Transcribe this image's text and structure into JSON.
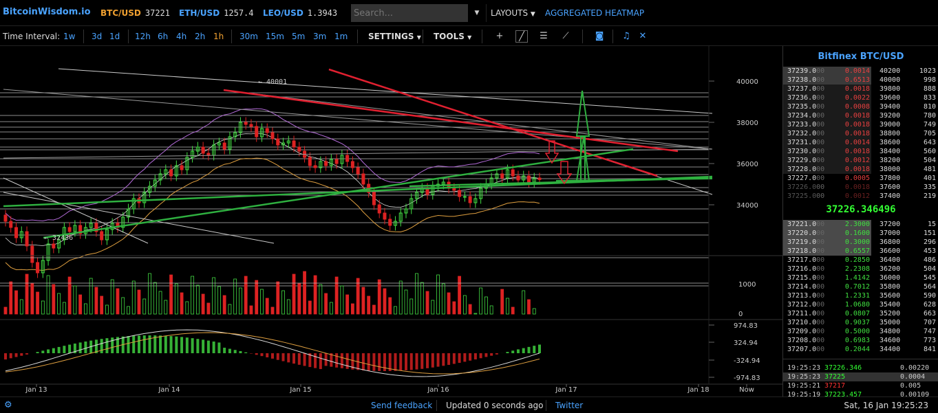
{
  "header": {
    "logo": "BitcoinWisdom.io",
    "tickers": [
      {
        "symbol": "BTC/USD",
        "price": "37221",
        "color": "#f0a030"
      },
      {
        "symbol": "ETH/USD",
        "price": "1257.4",
        "color": "#4aa3ff"
      },
      {
        "symbol": "LEO/USD",
        "price": "1.3943",
        "color": "#4aa3ff"
      }
    ],
    "search_placeholder": "Search...",
    "layouts_label": "LAYOUTS",
    "heatmap_label": "AGGREGATED HEATMAP"
  },
  "toolbar": {
    "time_interval_label": "Time Interval:",
    "intervals": [
      "1w",
      "3d",
      "1d",
      "12h",
      "6h",
      "4h",
      "2h",
      "1h",
      "30m",
      "15m",
      "5m",
      "3m",
      "1m"
    ],
    "selected_interval": "1h",
    "settings_label": "SETTINGS",
    "tools_label": "TOOLS",
    "icons": [
      "crosshair-icon",
      "line-tool-icon",
      "horizontal-lines-icon",
      "fan-tool-icon",
      "camera-icon",
      "bell-icon",
      "fullscreen-icon"
    ]
  },
  "chart_data": {
    "type": "candlestick",
    "price_axis": [
      "40000",
      "38000",
      "36000",
      "34000"
    ],
    "volume_axis": [
      "1000",
      "0"
    ],
    "macd_axis": [
      "974.83",
      "324.94",
      "-324.94",
      "-974.83"
    ],
    "x_axis": [
      "Jan 13",
      "Jan 14",
      "Jan 15",
      "Jan 16",
      "Jan 17",
      "Jan 18",
      "Now"
    ],
    "high_label": "← 40001",
    "low_label": "← 32436",
    "closes": [
      35200,
      34900,
      34400,
      34700,
      34000,
      33200,
      32700,
      33300,
      34100,
      33900,
      34300,
      34900,
      34700,
      35000,
      34600,
      34900,
      35100,
      34700,
      34300,
      34800,
      35100,
      34900,
      35400,
      35800,
      36300,
      36100,
      36600,
      36900,
      37200,
      37500,
      37700,
      37400,
      37900,
      37700,
      38300,
      38600,
      38800,
      38500,
      38400,
      38900,
      39000,
      38700,
      39300,
      39500,
      40000,
      39900,
      39800,
      39300,
      39700,
      39500,
      39200,
      38900,
      39000,
      39100,
      38800,
      38600,
      38300,
      37900,
      37800,
      38100,
      37900,
      38200,
      38000,
      38400,
      38100,
      37800,
      37500,
      37000,
      36600,
      36000,
      35600,
      35300,
      35000,
      35200,
      35600,
      35800,
      36300,
      36600,
      36800,
      36500,
      36900,
      37000,
      37100,
      36800,
      36700,
      36400,
      36400,
      36100,
      36300,
      36800,
      37000,
      37300,
      37500,
      37300,
      37700,
      37400,
      37200,
      37400,
      37100,
      37300,
      37221
    ]
  },
  "orderbook": {
    "title": "Bitfinex BTC/USD",
    "asks": [
      [
        "37239.0",
        "00",
        "0.0014",
        "40200",
        "1023"
      ],
      [
        "37238.0",
        "00",
        "0.6513",
        "40000",
        "998"
      ],
      [
        "37237.0",
        "00",
        "0.0018",
        "39800",
        "888"
      ],
      [
        "37236.0",
        "00",
        "0.0022",
        "39600",
        "833"
      ],
      [
        "37235.0",
        "00",
        "0.0008",
        "39400",
        "810"
      ],
      [
        "37234.0",
        "00",
        "0.0018",
        "39200",
        "780"
      ],
      [
        "37233.0",
        "00",
        "0.0018",
        "39000",
        "749"
      ],
      [
        "37232.0",
        "00",
        "0.0018",
        "38800",
        "705"
      ],
      [
        "37231.0",
        "00",
        "0.0014",
        "38600",
        "643"
      ],
      [
        "37230.0",
        "00",
        "0.0018",
        "38400",
        "560"
      ],
      [
        "37229.0",
        "00",
        "0.0012",
        "38200",
        "504"
      ],
      [
        "37228.0",
        "00",
        "0.0018",
        "38000",
        "481"
      ],
      [
        "37227.0",
        "00",
        "0.0005",
        "37800",
        "401"
      ],
      [
        "37226.0",
        "00",
        "0.0018",
        "37600",
        "335"
      ],
      [
        "37225.0",
        "00",
        "0.0012",
        "37400",
        "219"
      ]
    ],
    "mid_price": "37226.346496",
    "bids": [
      [
        "37221.0",
        "00",
        "2.3000",
        "37200",
        "15"
      ],
      [
        "37220.0",
        "00",
        "0.1600",
        "37000",
        "151"
      ],
      [
        "37219.0",
        "00",
        "0.3000",
        "36800",
        "296"
      ],
      [
        "37218.0",
        "00",
        "0.6557",
        "36600",
        "453"
      ],
      [
        "37217.0",
        "00",
        "0.2850",
        "36400",
        "486"
      ],
      [
        "37216.0",
        "00",
        "2.2308",
        "36200",
        "504"
      ],
      [
        "37215.0",
        "00",
        "1.4142",
        "36000",
        "545"
      ],
      [
        "37214.0",
        "00",
        "0.7012",
        "35800",
        "564"
      ],
      [
        "37213.0",
        "00",
        "1.2331",
        "35600",
        "590"
      ],
      [
        "37212.0",
        "00",
        "1.0680",
        "35400",
        "628"
      ],
      [
        "37211.0",
        "00",
        "0.0807",
        "35200",
        "663"
      ],
      [
        "37210.0",
        "00",
        "0.9037",
        "35000",
        "707"
      ],
      [
        "37209.0",
        "00",
        "0.5000",
        "34800",
        "747"
      ],
      [
        "37208.0",
        "00",
        "0.6983",
        "34600",
        "773"
      ],
      [
        "37207.0",
        "00",
        "0.2044",
        "34400",
        "841"
      ]
    ],
    "trades": [
      [
        "19:25:23",
        "37226.346",
        "0.00220",
        "#3f3"
      ],
      [
        "19:25:23",
        "37225",
        "0.0004",
        "#3f3"
      ],
      [
        "19:25:21",
        "37217",
        "0.005",
        "#f33"
      ],
      [
        "19:25:19",
        "37223.457",
        "0.00109",
        "#3f3"
      ]
    ]
  },
  "footer": {
    "feedback": "Send feedback",
    "updated": "Updated 0 seconds ago",
    "twitter": "Twitter",
    "clock": "Sat, 16 Jan 19:25:23"
  }
}
